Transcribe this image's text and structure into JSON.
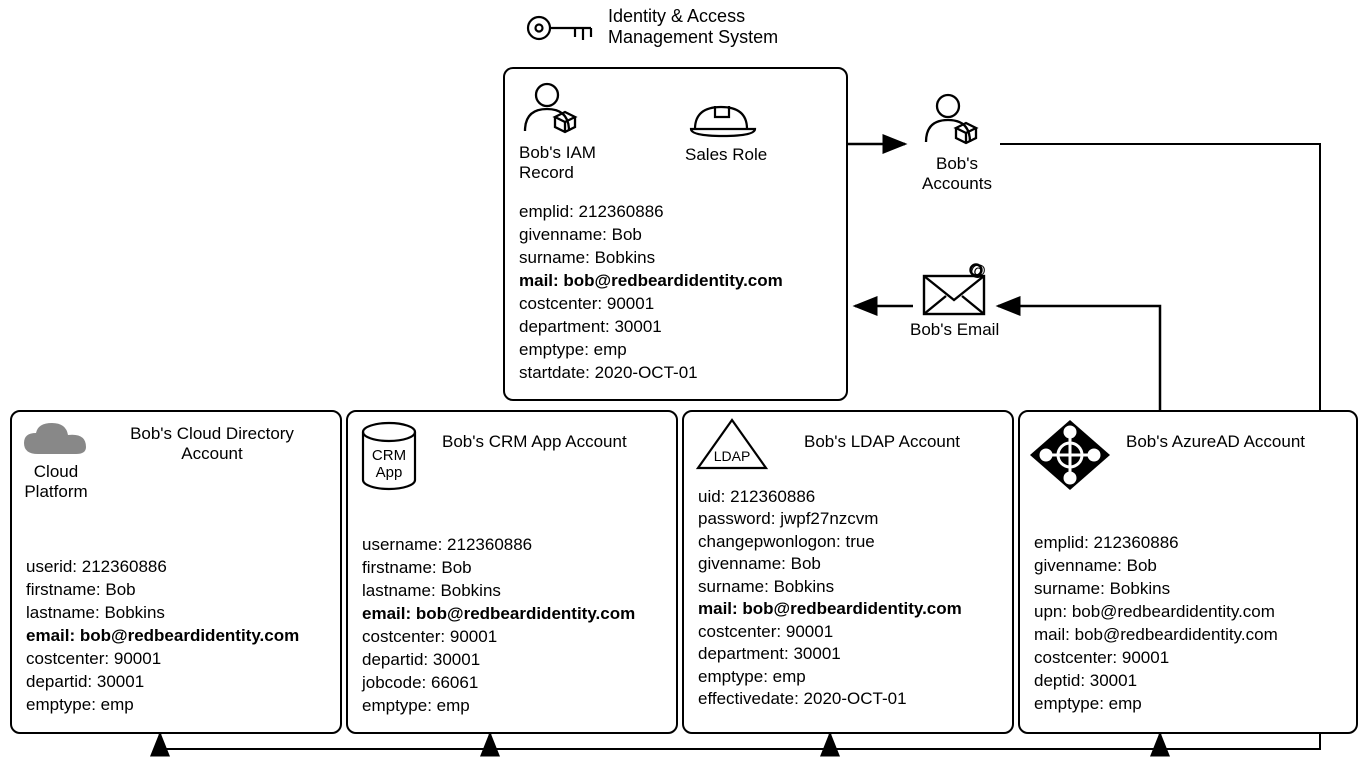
{
  "header": {
    "title_line1": "Identity & Access",
    "title_line2": "Management System"
  },
  "iam": {
    "title_line1": "Bob's IAM",
    "title_line2": "Record",
    "role": "Sales Role",
    "attrs": [
      {
        "k": "emplid",
        "v": "212360886"
      },
      {
        "k": "givenname",
        "v": "Bob"
      },
      {
        "k": "surname",
        "v": "Bobkins"
      },
      {
        "k": "mail",
        "v": "bob@redbeardidentity.com",
        "bold": true
      },
      {
        "k": "costcenter",
        "v": "90001"
      },
      {
        "k": "department",
        "v": "30001"
      },
      {
        "k": "emptype",
        "v": "emp"
      },
      {
        "k": "startdate",
        "v": "2020-OCT-01"
      }
    ]
  },
  "accounts_label_line1": "Bob's",
  "accounts_label_line2": "Accounts",
  "email_label": "Bob's Email",
  "cloud": {
    "title_line1": "Bob's Cloud Directory",
    "title_line2": "Account",
    "icon_label_line1": "Cloud",
    "icon_label_line2": "Platform",
    "attrs": [
      {
        "k": "userid",
        "v": "212360886"
      },
      {
        "k": "firstname",
        "v": "Bob"
      },
      {
        "k": "lastname",
        "v": "Bobkins"
      },
      {
        "k": "email",
        "v": "bob@redbeardidentity.com",
        "bold": true
      },
      {
        "k": "costcenter",
        "v": "90001"
      },
      {
        "k": "departid",
        "v": "30001"
      },
      {
        "k": "emptype",
        "v": "emp"
      }
    ]
  },
  "crm": {
    "title": "Bob's CRM App Account",
    "icon_label_line1": "CRM",
    "icon_label_line2": "App",
    "attrs": [
      {
        "k": "username",
        "v": "212360886"
      },
      {
        "k": "firstname",
        "v": "Bob"
      },
      {
        "k": "lastname",
        "v": "Bobkins"
      },
      {
        "k": "email",
        "v": "bob@redbeardidentity.com",
        "bold": true
      },
      {
        "k": "costcenter",
        "v": "90001"
      },
      {
        "k": "departid",
        "v": "30001"
      },
      {
        "k": "jobcode",
        "v": " 66061"
      },
      {
        "k": "emptype",
        "v": "emp"
      }
    ]
  },
  "ldap": {
    "title": "Bob's LDAP Account",
    "icon_label": "LDAP",
    "attrs": [
      {
        "k": "uid",
        "v": "212360886"
      },
      {
        "k": "password",
        "v": "jwpf27nzcvm"
      },
      {
        "k": "changepwonlogon",
        "v": "true"
      },
      {
        "k": "givenname",
        "v": "Bob"
      },
      {
        "k": "surname",
        "v": "Bobkins"
      },
      {
        "k": "mail",
        "v": "bob@redbeardidentity.com",
        "bold": true
      },
      {
        "k": "costcenter",
        "v": "90001"
      },
      {
        "k": "department",
        "v": "30001"
      },
      {
        "k": "emptype",
        "v": "emp"
      },
      {
        "k": "effectivedate",
        "v": "2020-OCT-01"
      }
    ]
  },
  "azure": {
    "title": "Bob's AzureAD Account",
    "attrs": [
      {
        "k": "emplid",
        "v": "212360886"
      },
      {
        "k": "givenname",
        "v": "Bob"
      },
      {
        "k": "surname",
        "v": "Bobkins"
      },
      {
        "k": "upn",
        "v": "bob@redbeardidentity.com"
      },
      {
        "k": "mail",
        "v": "bob@redbeardidentity.com"
      },
      {
        "k": "costcenter",
        "v": "90001"
      },
      {
        "k": "deptid",
        "v": "30001"
      },
      {
        "k": "emptype",
        "v": "emp"
      }
    ]
  }
}
